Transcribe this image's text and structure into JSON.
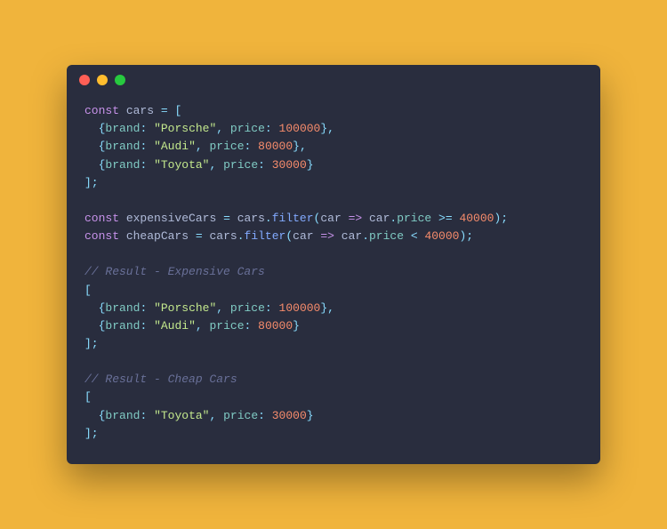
{
  "titlebar": {
    "buttons": [
      "close",
      "minimize",
      "zoom"
    ]
  },
  "code": {
    "l1": {
      "kw": "const",
      "var": "cars",
      "op": "=",
      "punc1": "["
    },
    "l2": {
      "punc1": "{",
      "prop1": "brand",
      "colon1": ":",
      "str": "\"Porsche\"",
      "comma1": ",",
      "prop2": "price",
      "colon2": ":",
      "num": "100000",
      "punc2": "},"
    },
    "l3": {
      "punc1": "{",
      "prop1": "brand",
      "colon1": ":",
      "str": "\"Audi\"",
      "comma1": ",",
      "prop2": "price",
      "colon2": ":",
      "num": "80000",
      "punc2": "},"
    },
    "l4": {
      "punc1": "{",
      "prop1": "brand",
      "colon1": ":",
      "str": "\"Toyota\"",
      "comma1": ",",
      "prop2": "price",
      "colon2": ":",
      "num": "30000",
      "punc2": "}"
    },
    "l5": {
      "punc": "];"
    },
    "l7": {
      "kw": "const",
      "var": "expensiveCars",
      "op1": "=",
      "obj": "cars",
      "dot": ".",
      "fn": "filter",
      "open": "(",
      "arg": "car",
      "arrow": "=>",
      "arg2": "car",
      "dot2": ".",
      "prop": "price",
      "cmp": ">=",
      "num": "40000",
      "close": ");"
    },
    "l8": {
      "kw": "const",
      "var": "cheapCars",
      "op1": "=",
      "obj": "cars",
      "dot": ".",
      "fn": "filter",
      "open": "(",
      "arg": "car",
      "arrow": "=>",
      "arg2": "car",
      "dot2": ".",
      "prop": "price",
      "cmp": "<",
      "num": "40000",
      "close": ");"
    },
    "l10": {
      "cmt": "// Result - Expensive Cars"
    },
    "l11": {
      "punc": "["
    },
    "l12": {
      "punc1": "{",
      "prop1": "brand",
      "colon1": ":",
      "str": "\"Porsche\"",
      "comma1": ",",
      "prop2": "price",
      "colon2": ":",
      "num": "100000",
      "punc2": "},"
    },
    "l13": {
      "punc1": "{",
      "prop1": "brand",
      "colon1": ":",
      "str": "\"Audi\"",
      "comma1": ",",
      "prop2": "price",
      "colon2": ":",
      "num": "80000",
      "punc2": "}"
    },
    "l14": {
      "punc": "];"
    },
    "l16": {
      "cmt": "// Result - Cheap Cars"
    },
    "l17": {
      "punc": "["
    },
    "l18": {
      "punc1": "{",
      "prop1": "brand",
      "colon1": ":",
      "str": "\"Toyota\"",
      "comma1": ",",
      "prop2": "price",
      "colon2": ":",
      "num": "30000",
      "punc2": "}"
    },
    "l19": {
      "punc": "];"
    }
  }
}
